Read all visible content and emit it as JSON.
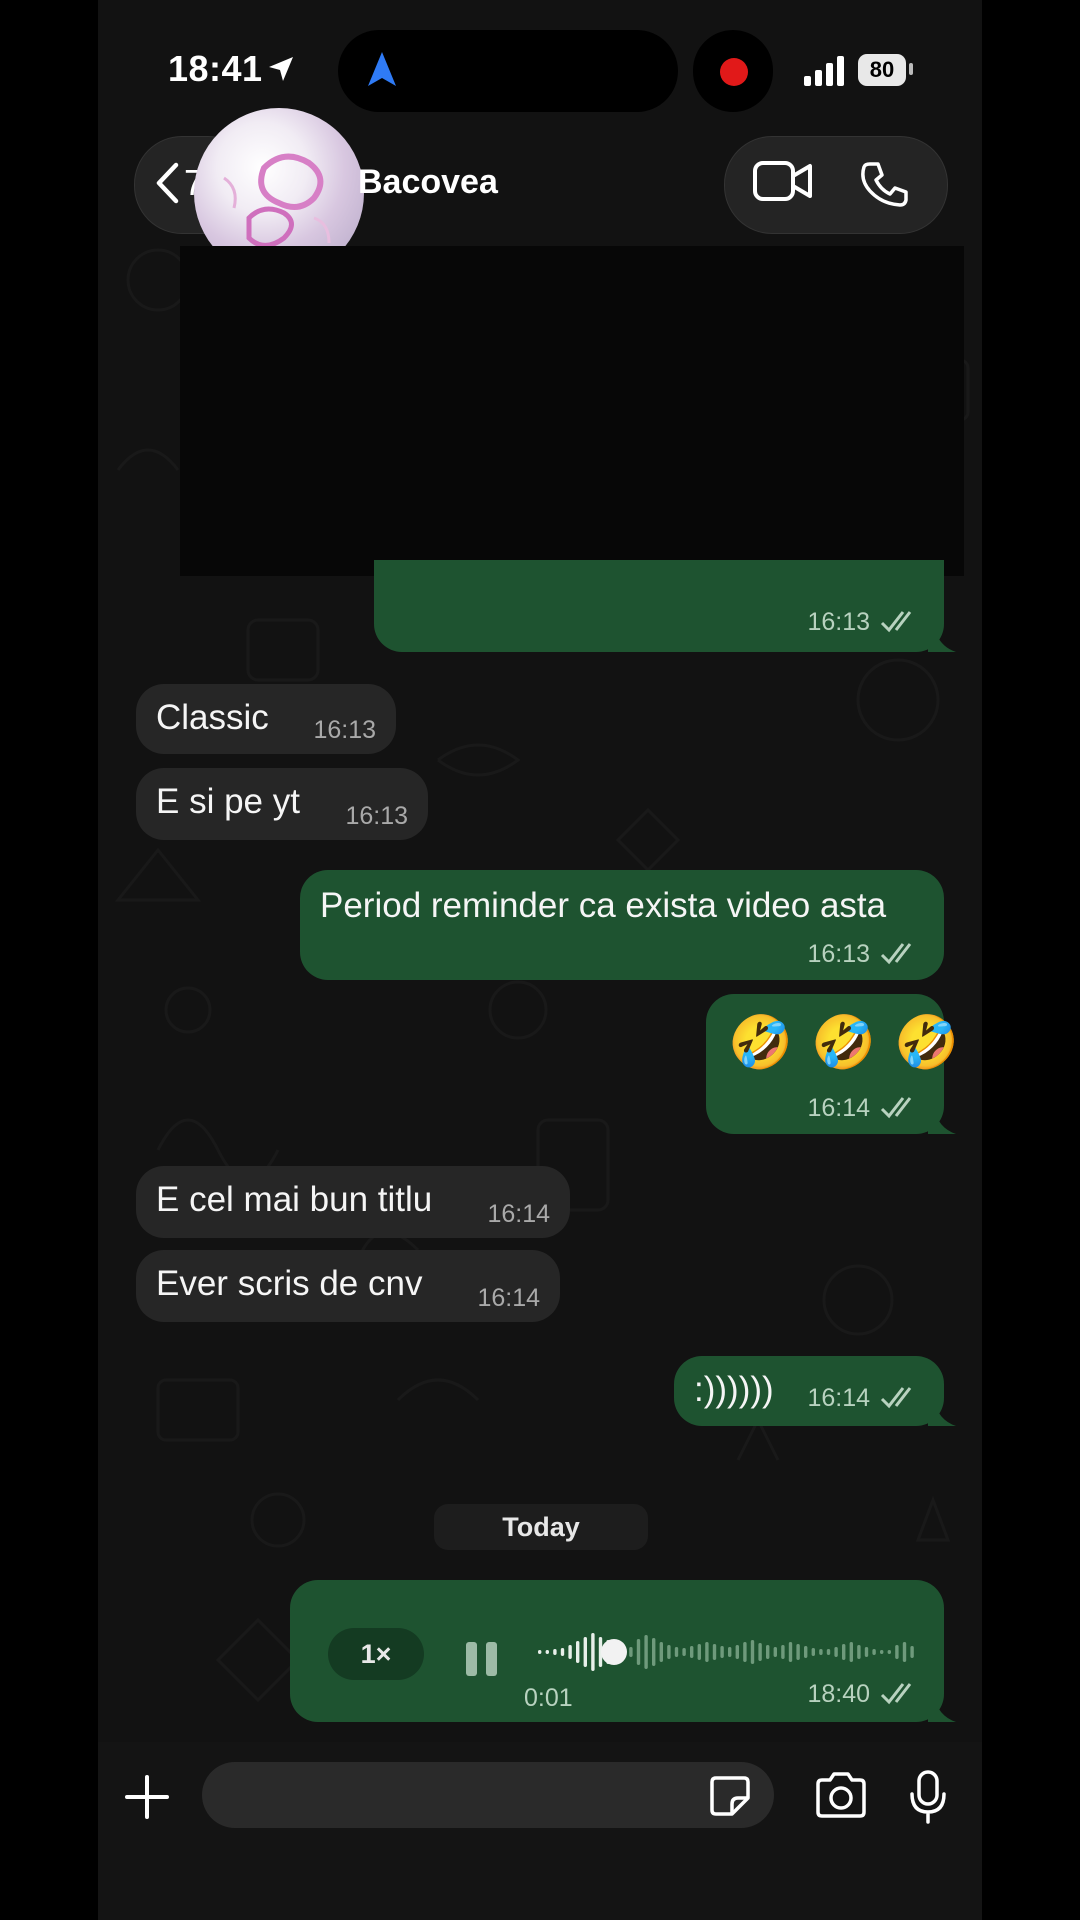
{
  "status_bar": {
    "time": "18:41",
    "battery": "80"
  },
  "header": {
    "back_count": "7",
    "contact_name": "Bacovea"
  },
  "messages": [
    {
      "dir": "out",
      "text": "",
      "time": "16:13"
    },
    {
      "dir": "in",
      "text": "Classic",
      "time": "16:13"
    },
    {
      "dir": "in",
      "text": "E si pe yt",
      "time": "16:13"
    },
    {
      "dir": "out",
      "text": "Period reminder ca exista video asta",
      "time": "16:13"
    },
    {
      "dir": "out",
      "text": "🤣 🤣 🤣",
      "time": "16:14"
    },
    {
      "dir": "in",
      "text": "E cel mai bun titlu",
      "time": "16:14"
    },
    {
      "dir": "in",
      "text": "Ever scris de cnv",
      "time": "16:14"
    },
    {
      "dir": "out",
      "text": ":))))))",
      "time": "16:14"
    }
  ],
  "date_divider": "Today",
  "voice_note": {
    "speed": "1×",
    "elapsed": "0:01",
    "time": "18:40",
    "progress": 0.2
  },
  "input": {
    "placeholder": ""
  },
  "colors": {
    "outgoing_bubble": "#1e5330",
    "incoming_bubble": "#262626",
    "background": "#121212",
    "tick": "#b8d2bf"
  }
}
